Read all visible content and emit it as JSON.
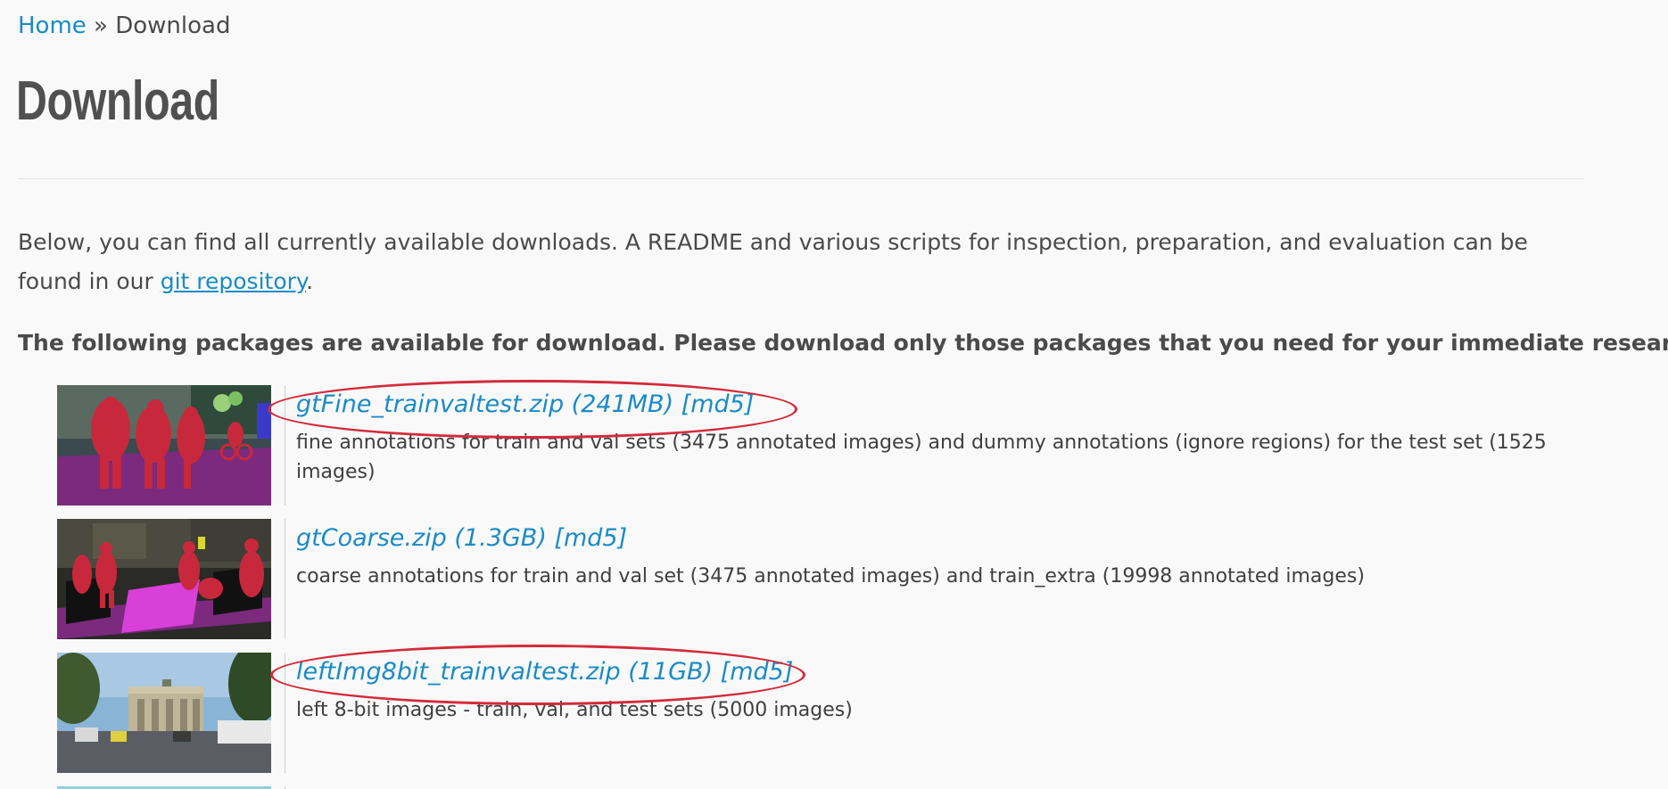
{
  "breadcrumb": {
    "home": "Home",
    "separator": "»",
    "current": "Download"
  },
  "page": {
    "title": "Download"
  },
  "intro": {
    "text_before": "Below, you can find all currently available downloads. A README and various scripts for inspection, preparation, and evaluation can be found in our ",
    "link": "git repository",
    "text_after": "."
  },
  "notice": "The following packages are available for download. Please download only those packages that you need for your immediate research.",
  "packages": [
    {
      "link": "gtFine_trainvaltest.zip (241MB) [md5]",
      "description": "fine annotations for train and val sets (3475 annotated images) and dummy annotations (ignore regions) for the test set (1525 images)",
      "circled": true
    },
    {
      "link": "gtCoarse.zip (1.3GB) [md5]",
      "description": "coarse annotations for train and val set (3475 annotated images) and train_extra (19998 annotated images)",
      "circled": false
    },
    {
      "link": "leftImg8bit_trainvaltest.zip (11GB) [md5]",
      "description": "left 8-bit images - train, val, and test sets (5000 images)",
      "circled": true
    }
  ],
  "colors": {
    "link": "#1a8bc6",
    "annotation_circle": "#d42a3a",
    "segment_person": "#c8283c",
    "segment_road": "#7b2a7d",
    "segment_sidewalk": "#d840d8"
  }
}
